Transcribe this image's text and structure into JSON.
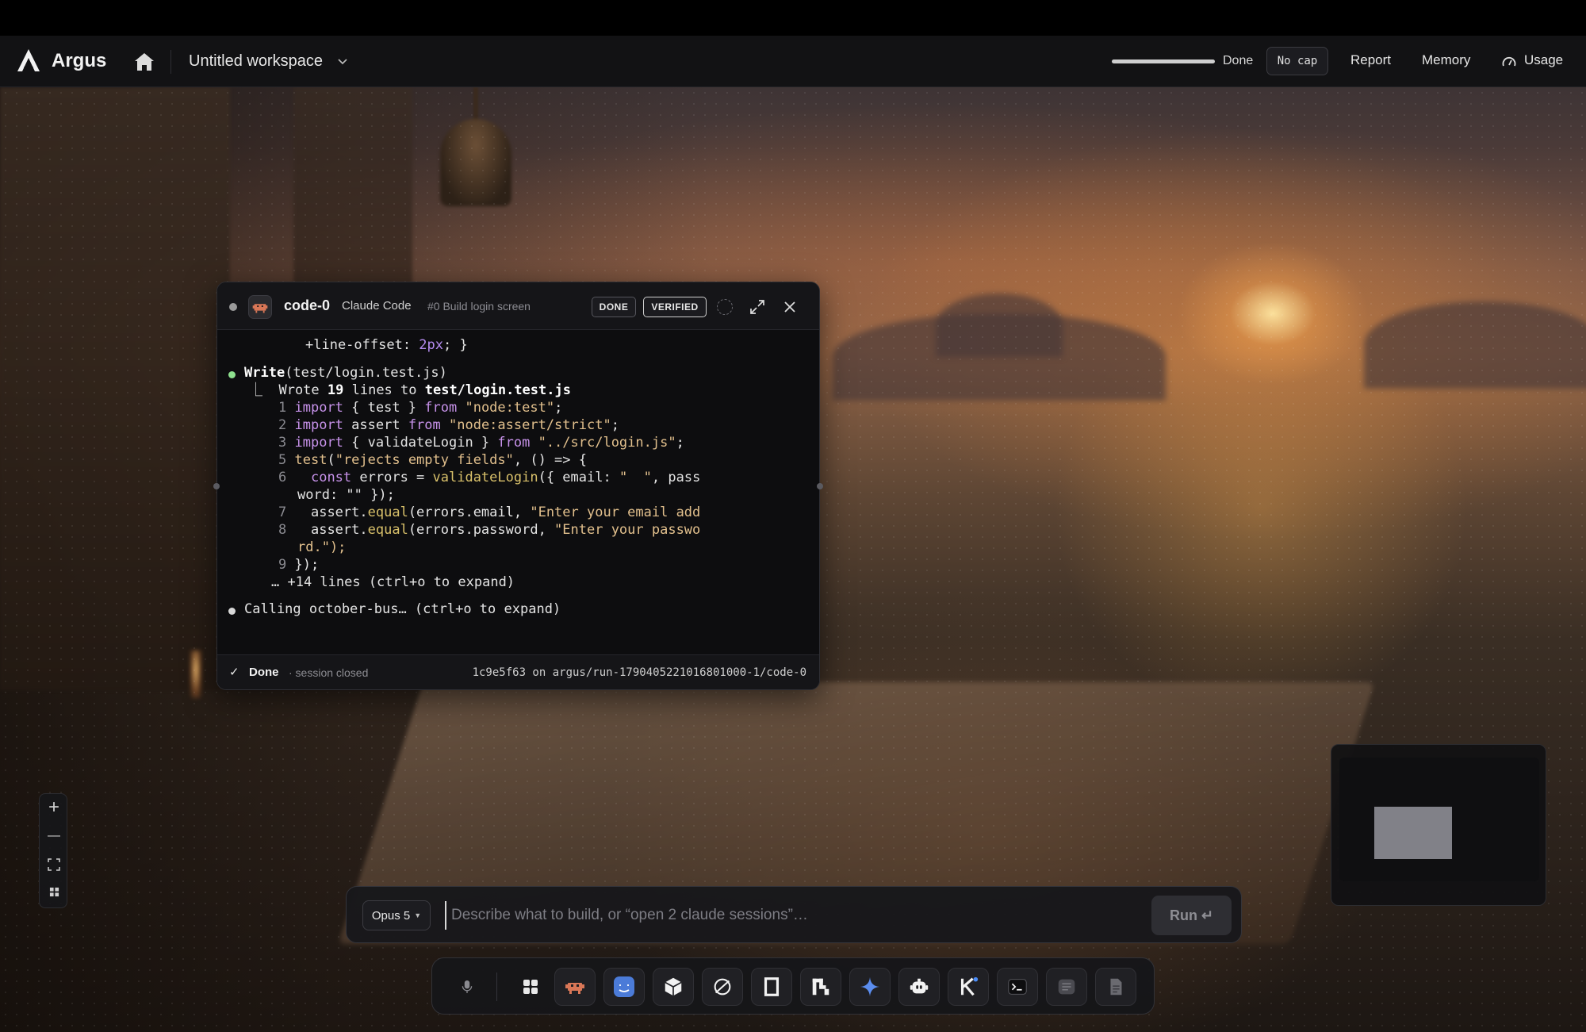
{
  "app": {
    "brand": "Argus",
    "workspace": "Untitled workspace"
  },
  "header": {
    "status_text": "Done",
    "progress": 1.0,
    "cap_label": "No cap",
    "links": [
      "Report",
      "Memory",
      "Usage"
    ]
  },
  "session": {
    "name": "code-0",
    "agent": "Claude Code",
    "task": "#0 Build login screen",
    "badges": [
      "DONE",
      "VERIFIED"
    ],
    "footer": {
      "status": "Done",
      "detail": "· session closed",
      "commit": "1c9e5f63 on argus/run-1790405221016801000-1/code-0"
    },
    "log": {
      "prev_line_a": "+line-offset: ",
      "prev_line_b": "2px",
      "prev_line_c": "; }",
      "write_tool": "Write",
      "write_arg": "(test/login.test.js)",
      "wrote_prefix": "⎿  Wrote ",
      "wrote_count": "19",
      "wrote_mid": " lines to ",
      "wrote_file": "test/login.test.js",
      "code": {
        "n1": "1",
        "n2": "2",
        "n3": "3",
        "n5": "5",
        "n6": "6",
        "n7": "7",
        "n8": "8",
        "n9": "9",
        "l1_kw": "import",
        "l1_a": " { test } ",
        "l1_from": "from",
        "l1_str": " \"node:test\"",
        "l1_end": ";",
        "l2_kw": "import",
        "l2_a": " assert ",
        "l2_from": "from",
        "l2_str": " \"node:assert/strict\"",
        "l2_end": ";",
        "l3_kw": "import",
        "l3_a": " { validateLogin } ",
        "l3_from": "from",
        "l3_str": " \"../src/login.js\"",
        "l3_end": ";",
        "l5_fn": "test",
        "l5_a": "(",
        "l5_str": "\"rejects empty fields\"",
        "l5_b": ", () => {",
        "l6_kw": "  const",
        "l6_a": " errors = ",
        "l6_call": "validateLogin",
        "l6_b": "({ email: ",
        "l6_str": "\"  \"",
        "l6_c": ", pass",
        "l6_wrap": "word: \"\" });",
        "l7_a": "  assert.",
        "l7_call": "equal",
        "l7_b": "(errors.email, ",
        "l7_str": "\"Enter your email add",
        "l8_a": "  assert.",
        "l8_call": "equal",
        "l8_b": "(errors.password, ",
        "l8_str": "\"Enter your passwo",
        "l8_wrap": "rd.\");",
        "l9_a": "});"
      },
      "more_lines": "… +14 lines (ctrl+o to expand)",
      "calling": "Calling october-bus… (ctrl+o to expand)"
    }
  },
  "prompt": {
    "model": "Opus 5",
    "placeholder": "Describe what to build, or “open 2 claude sessions”…",
    "run_label": "Run ↵"
  },
  "zoom": {
    "in": "+",
    "out": "—"
  },
  "dock": [
    "mic-icon",
    "apps-grid-icon",
    "claude-code-icon",
    "finder-icon",
    "cube-icon",
    "openai-icon",
    "frame-icon",
    "pixel-icon",
    "gemini-icon",
    "robot-icon",
    "k-icon",
    "terminal-icon",
    "notes-icon",
    "document-icon"
  ],
  "colors": {
    "accent_keyword": "#c792ea",
    "accent_string": "#e2c08d",
    "status_green": "#8ee08e"
  }
}
